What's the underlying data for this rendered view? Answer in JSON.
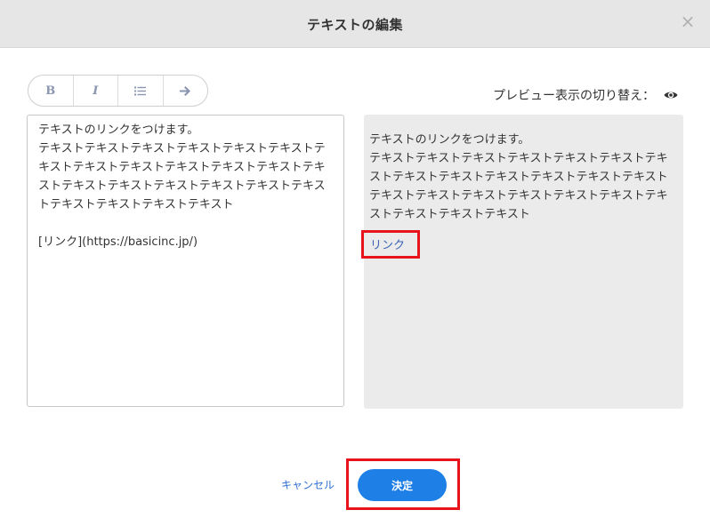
{
  "dialog": {
    "title": "テキストの編集",
    "close_label": "×"
  },
  "toolbar": {
    "bold_label": "B",
    "italic_label": "I",
    "list_icon": "list-icon",
    "link_icon": "arrow-right-icon"
  },
  "preview_toggle": {
    "label": "プレビュー表示の切り替え：",
    "icon": "eye-icon"
  },
  "editor": {
    "value": "テキストのリンクをつけます。\nテキストテキストテキストテキストテキストテキストテキストテキストテキストテキストテキストテキストテキストテキストテキストテキストテキストテキストテキストテキストテキストテキストテキスト\n\n[リンク](https://basicinc.jp/)"
  },
  "preview": {
    "text": "テキストのリンクをつけます。\nテキストテキストテキストテキストテキストテキストテキストテキストテキストテキストテキストテキストテキストテキストテキストテキストテキストテキストテキストテキストテキストテキストテキスト",
    "link_label": "リンク"
  },
  "footer": {
    "cancel_label": "キャンセル",
    "confirm_label": "決定"
  },
  "colors": {
    "accent": "#1e7fe6",
    "highlight": "#e8141b",
    "link": "#3a63b5"
  }
}
